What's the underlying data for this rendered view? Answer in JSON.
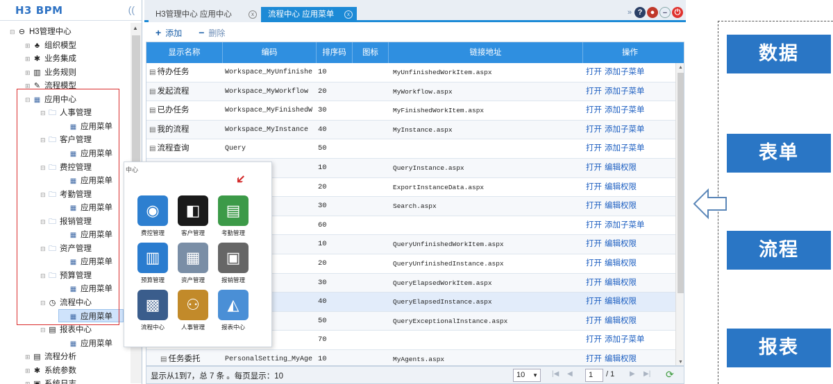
{
  "app": {
    "logo": "H3 BPM",
    "collapse": "(("
  },
  "tree": {
    "items": [
      {
        "label": "H3管理中心",
        "icon": "minus-circle-icon"
      },
      {
        "label": "组织模型",
        "icon": "org-icon"
      },
      {
        "label": "业务集成",
        "icon": "gear-icon"
      },
      {
        "label": "业务规则",
        "icon": "rule-icon"
      },
      {
        "label": "流程模型",
        "icon": "pen-icon"
      },
      {
        "label": "应用中心",
        "icon": "grid-icon"
      },
      {
        "label": "人事管理",
        "icon": "folder-icon"
      },
      {
        "label": "应用菜单",
        "icon": "grid-icon"
      },
      {
        "label": "客户管理",
        "icon": "folder-icon"
      },
      {
        "label": "应用菜单",
        "icon": "grid-icon"
      },
      {
        "label": "费控管理",
        "icon": "folder-icon"
      },
      {
        "label": "应用菜单",
        "icon": "grid-icon"
      },
      {
        "label": "考勤管理",
        "icon": "folder-icon"
      },
      {
        "label": "应用菜单",
        "icon": "grid-icon"
      },
      {
        "label": "报销管理",
        "icon": "folder-icon"
      },
      {
        "label": "应用菜单",
        "icon": "grid-icon"
      },
      {
        "label": "资产管理",
        "icon": "folder-icon"
      },
      {
        "label": "应用菜单",
        "icon": "grid-icon"
      },
      {
        "label": "预算管理",
        "icon": "folder-icon"
      },
      {
        "label": "应用菜单",
        "icon": "grid-icon"
      },
      {
        "label": "流程中心",
        "icon": "clock-icon"
      },
      {
        "label": "应用菜单",
        "icon": "grid-icon"
      },
      {
        "label": "报表中心",
        "icon": "chart-icon"
      },
      {
        "label": "应用菜单",
        "icon": "grid-icon"
      },
      {
        "label": "流程分析",
        "icon": "chart-icon"
      },
      {
        "label": "系统参数",
        "icon": "gear-icon"
      },
      {
        "label": "系统日志",
        "icon": "log-icon"
      }
    ]
  },
  "tabs": [
    {
      "label": "H3管理中心 应用中心",
      "close": "x"
    },
    {
      "label": "流程中心 应用菜单",
      "close": "x"
    }
  ],
  "toolbar": {
    "add": "添加",
    "delete": "删除"
  },
  "grid": {
    "headers": [
      "显示名称",
      "编码",
      "排序码",
      "图标",
      "链接地址",
      "操作"
    ],
    "rows": [
      {
        "name": "待办任务",
        "code": "Workspace_MyUnfinishe",
        "order": "10",
        "link": "MyUnfinishedWorkItem.aspx",
        "op1": "打开",
        "op2": "添加子菜单"
      },
      {
        "name": "发起流程",
        "code": "Workspace_MyWorkflow",
        "order": "20",
        "link": "MyWorkflow.aspx",
        "op1": "打开",
        "op2": "添加子菜单"
      },
      {
        "name": "已办任务",
        "code": "Workspace_MyFinishedW",
        "order": "30",
        "link": "MyFinishedWorkItem.aspx",
        "op1": "打开",
        "op2": "添加子菜单"
      },
      {
        "name": "我的流程",
        "code": "Workspace_MyInstance",
        "order": "40",
        "link": "MyInstance.aspx",
        "op1": "打开",
        "op2": "添加子菜单"
      },
      {
        "name": "流程查询",
        "code": "Query",
        "order": "50",
        "link": "",
        "op1": "打开",
        "op2": "添加子菜单"
      },
      {
        "name": "",
        "code": "ce",
        "order": "10",
        "link": "QueryInstance.aspx",
        "op1": "打开",
        "op2": "编辑权限"
      },
      {
        "name": "",
        "code": "Data",
        "order": "20",
        "link": "ExportInstanceData.aspx",
        "op1": "打开",
        "op2": "编辑权限"
      },
      {
        "name": "",
        "code": "",
        "order": "30",
        "link": "Search.aspx",
        "op1": "打开",
        "op2": "编辑权限"
      },
      {
        "name": "",
        "code": "",
        "order": "60",
        "link": "",
        "op1": "打开",
        "op2": "添加子菜单"
      },
      {
        "name": "",
        "code": "inishedWor",
        "order": "10",
        "link": "QueryUnfinishedWorkItem.aspx",
        "op1": "打开",
        "op2": "编辑权限"
      },
      {
        "name": "",
        "code": "inishedIns",
        "order": "20",
        "link": "QueryUnfinishedInstance.aspx",
        "op1": "打开",
        "op2": "编辑权限"
      },
      {
        "name": "",
        "code": "sedWorkIt",
        "order": "30",
        "link": "QueryElapsedWorkItem.aspx",
        "op1": "打开",
        "op2": "编辑权限"
      },
      {
        "name": "",
        "code": "sedInstan",
        "order": "40",
        "link": "QueryElapsedInstance.aspx",
        "op1": "打开",
        "op2": "编辑权限"
      },
      {
        "name": "",
        "code": "ptionalIn",
        "order": "50",
        "link": "QueryExceptionalInstance.aspx",
        "op1": "打开",
        "op2": "编辑权限"
      },
      {
        "name": "",
        "code": "ing",
        "order": "70",
        "link": "",
        "op1": "打开",
        "op2": "添加子菜单"
      },
      {
        "name": "任务委托",
        "code": "PersonalSetting_MyAge",
        "order": "10",
        "link": "MyAgents.aspx",
        "op1": "打开",
        "op2": "编辑权限"
      }
    ]
  },
  "pager": {
    "info": "显示从1到7，总 7 条 。每页显示：10",
    "page_size": "10",
    "page": "1",
    "total": "/ 1"
  },
  "popup": {
    "title": "中心",
    "apps": [
      {
        "label": "费控管理",
        "color": "#2d7fd0"
      },
      {
        "label": "客户管理",
        "color": "#1a1a1a"
      },
      {
        "label": "考勤管理",
        "color": "#3c9a48"
      },
      {
        "label": "预算管理",
        "color": "#2a7ccf"
      },
      {
        "label": "资产管理",
        "color": "#7a8ea6"
      },
      {
        "label": "报销管理",
        "color": "#666666"
      },
      {
        "label": "流程中心",
        "color": "#3a5d8c"
      },
      {
        "label": "人事管理",
        "color": "#c28a2a"
      },
      {
        "label": "报表中心",
        "color": "#4a8fd6"
      }
    ]
  },
  "concepts": [
    "数据",
    "表单",
    "流程",
    "报表"
  ],
  "colors": {
    "accent": "#1c8ad6",
    "header": "#2f8fe0",
    "concept": "#2a76c5",
    "highlight": "#d92a2a"
  }
}
